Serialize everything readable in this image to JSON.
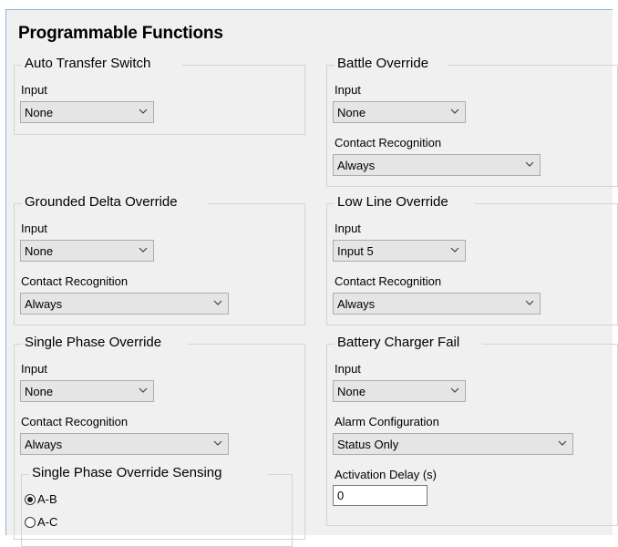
{
  "title": "Programmable Functions",
  "groups": {
    "ats": {
      "label": "Auto Transfer Switch",
      "input_label": "Input",
      "input_value": "None"
    },
    "battle": {
      "label": "Battle Override",
      "input_label": "Input",
      "input_value": "None",
      "contact_label": "Contact Recognition",
      "contact_value": "Always"
    },
    "gdo": {
      "label": "Grounded Delta Override",
      "input_label": "Input",
      "input_value": "None",
      "contact_label": "Contact Recognition",
      "contact_value": "Always"
    },
    "llo": {
      "label": "Low Line Override",
      "input_label": "Input",
      "input_value": "Input 5",
      "contact_label": "Contact Recognition",
      "contact_value": "Always"
    },
    "spo": {
      "label": "Single Phase Override",
      "input_label": "Input",
      "input_value": "None",
      "contact_label": "Contact Recognition",
      "contact_value": "Always"
    },
    "sensing": {
      "label": "Single Phase Override Sensing",
      "options": [
        "A-B",
        "A-C"
      ],
      "selected": "A-B"
    },
    "bcf": {
      "label": "Battery Charger Fail",
      "input_label": "Input",
      "input_value": "None",
      "alarm_label": "Alarm Configuration",
      "alarm_value": "Status Only",
      "delay_label": "Activation Delay (s)",
      "delay_value": "0"
    }
  }
}
